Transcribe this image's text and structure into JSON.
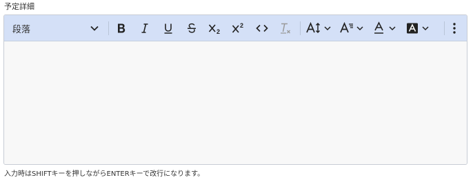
{
  "field": {
    "label": "予定詳細",
    "hint": "入力時はSHIFTキーを押しながらENTERキーで改行になります。"
  },
  "toolbar": {
    "paragraph_format": "段落",
    "buttons": [
      {
        "name": "bold",
        "icon": "bold-icon"
      },
      {
        "name": "italic",
        "icon": "italic-icon"
      },
      {
        "name": "underline",
        "icon": "underline-icon"
      },
      {
        "name": "strikethrough",
        "icon": "strikethrough-icon"
      },
      {
        "name": "subscript",
        "icon": "subscript-icon"
      },
      {
        "name": "superscript",
        "icon": "superscript-icon"
      },
      {
        "name": "code",
        "icon": "code-icon"
      },
      {
        "name": "clear-format",
        "icon": "clear-format-icon"
      },
      {
        "name": "font-size",
        "icon": "font-size-icon",
        "dropdown": true
      },
      {
        "name": "font-family",
        "icon": "font-family-icon",
        "dropdown": true
      },
      {
        "name": "font-color",
        "icon": "font-color-icon",
        "dropdown": true
      },
      {
        "name": "background-color",
        "icon": "background-color-icon",
        "dropdown": true
      },
      {
        "name": "more",
        "icon": "more-vertical-icon"
      }
    ]
  },
  "editor": {
    "content": ""
  },
  "colors": {
    "toolbar_bg": "#d4e0f7",
    "editor_bg": "#f8f8f8",
    "border": "#c7ccd4",
    "icon": "#222222"
  }
}
